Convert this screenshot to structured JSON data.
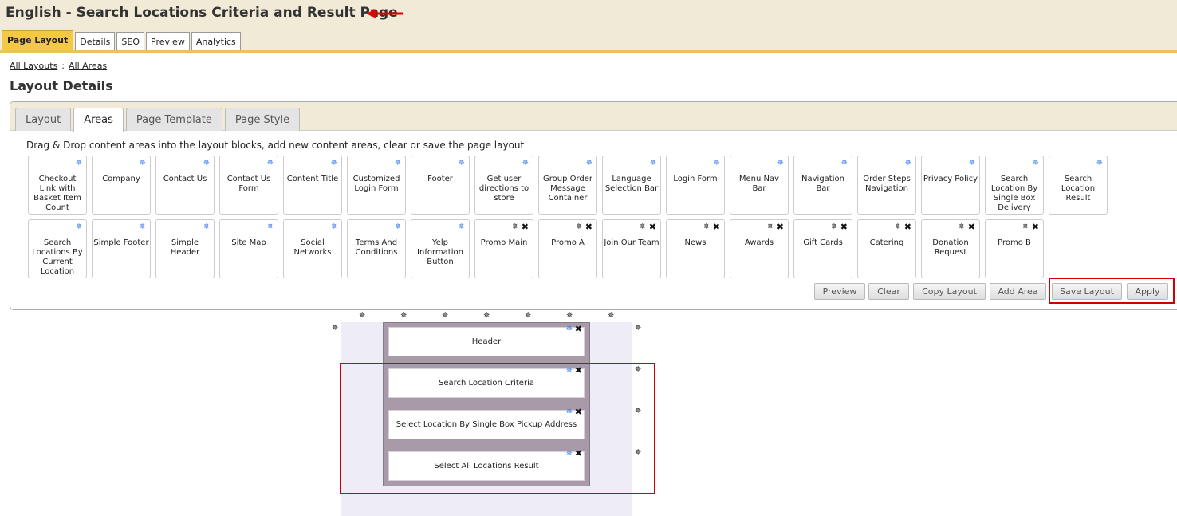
{
  "header": {
    "title": "English - Search Locations Criteria and Result Page"
  },
  "top_tabs": [
    {
      "label": "Page Layout",
      "active": true
    },
    {
      "label": "Details"
    },
    {
      "label": "SEO"
    },
    {
      "label": "Preview"
    },
    {
      "label": "Analytics"
    }
  ],
  "breadcrumb": {
    "item1": "All Layouts",
    "separator": ":",
    "item2": "All Areas"
  },
  "section_title": "Layout Details",
  "panel_tabs": [
    {
      "label": "Layout"
    },
    {
      "label": "Areas",
      "active": true
    },
    {
      "label": "Page Template"
    },
    {
      "label": "Page Style"
    }
  ],
  "instructions": "Drag & Drop content areas into the layout blocks, add new content areas, clear or save the page layout",
  "content_areas": [
    {
      "label": "Checkout Link with Basket Item Count",
      "icon": "gear-blue"
    },
    {
      "label": "Company",
      "icon": "gear-blue"
    },
    {
      "label": "Contact Us",
      "icon": "gear-blue"
    },
    {
      "label": "Contact Us Form",
      "icon": "gear-blue"
    },
    {
      "label": "Content Title",
      "icon": "gear-blue"
    },
    {
      "label": "Customized Login Form",
      "icon": "gear-blue"
    },
    {
      "label": "Footer",
      "icon": "gear-blue"
    },
    {
      "label": "Get user directions to store",
      "icon": "gear-blue"
    },
    {
      "label": "Group Order Message Container",
      "icon": "gear-blue"
    },
    {
      "label": "Language Selection Bar",
      "icon": "gear-blue"
    },
    {
      "label": "Login Form",
      "icon": "gear-blue"
    },
    {
      "label": "Menu Nav Bar",
      "icon": "gear-blue"
    },
    {
      "label": "Navigation Bar",
      "icon": "gear-blue"
    },
    {
      "label": "Order Steps Navigation",
      "icon": "gear-blue"
    },
    {
      "label": "Privacy Policy",
      "icon": "gear-blue"
    },
    {
      "label": "Search Location By Single Box Delivery Address",
      "icon": "gear-blue"
    },
    {
      "label": "Search Location Result",
      "icon": "gear-blue"
    },
    {
      "label": "Search Locations By Current Location",
      "icon": "gear-blue"
    },
    {
      "label": "Simple Footer",
      "icon": "gear-blue"
    },
    {
      "label": "Simple Header",
      "icon": "gear-blue"
    },
    {
      "label": "Site Map",
      "icon": "gear-blue"
    },
    {
      "label": "Social Networks",
      "icon": "gear-blue"
    },
    {
      "label": "Terms And Conditions",
      "icon": "gear-blue"
    },
    {
      "label": "Yelp Information Button",
      "icon": "gear-blue"
    },
    {
      "label": "Promo Main",
      "icon": "gear-close"
    },
    {
      "label": "Promo A",
      "icon": "gear-close"
    },
    {
      "label": "Join Our Team",
      "icon": "gear-close"
    },
    {
      "label": "News",
      "icon": "gear-close"
    },
    {
      "label": "Awards",
      "icon": "gear-close"
    },
    {
      "label": "Gift Cards",
      "icon": "gear-close"
    },
    {
      "label": "Catering",
      "icon": "gear-close"
    },
    {
      "label": "Donation Request",
      "icon": "gear-close"
    },
    {
      "label": "Promo B",
      "icon": "gear-close"
    }
  ],
  "buttons": {
    "preview": "Preview",
    "clear": "Clear",
    "copy_layout": "Copy Layout",
    "add_area": "Add Area",
    "save_layout": "Save Layout",
    "apply": "Apply"
  },
  "layout_blocks": [
    {
      "label": "Header"
    },
    {
      "label": "Search Location Criteria"
    },
    {
      "label": "Select Location By Single Box Pickup Address"
    },
    {
      "label": "Select All Locations Result"
    }
  ],
  "colors": {
    "accent": "#f3c844",
    "title_bg": "#f1ead7",
    "highlight": "#d00000",
    "gear_blue": "#3c7de0"
  }
}
